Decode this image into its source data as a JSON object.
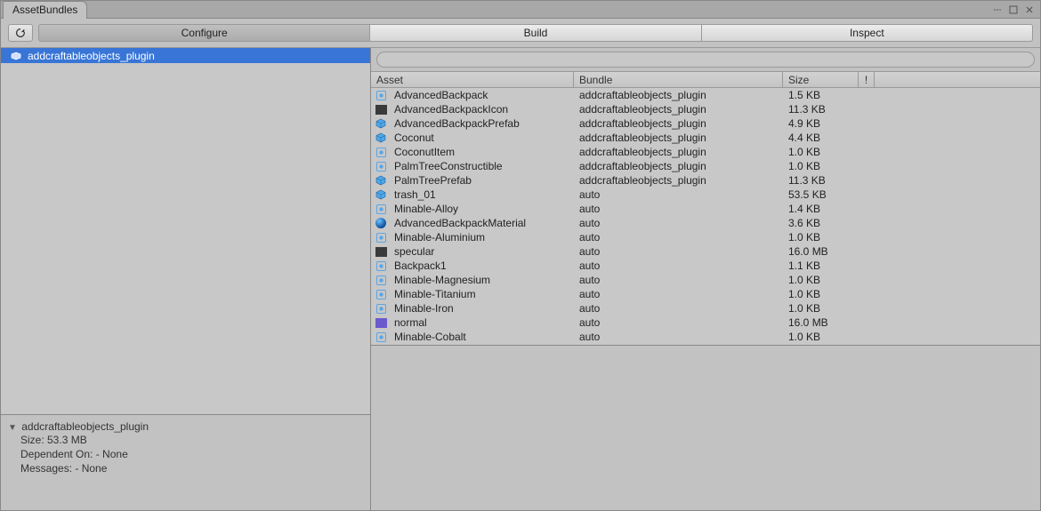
{
  "window": {
    "title": "AssetBundles"
  },
  "tabs": {
    "configure": "Configure",
    "build": "Build",
    "inspect": "Inspect",
    "active": "configure"
  },
  "search": {
    "placeholder": ""
  },
  "sidebar": {
    "bundles": [
      {
        "name": "addcraftableobjects_plugin",
        "selected": true
      }
    ]
  },
  "details": {
    "title": "addcraftableobjects_plugin",
    "lines": [
      "Size: 53.3 MB",
      "Dependent On: - None",
      "Messages: - None"
    ]
  },
  "columns": {
    "asset": "Asset",
    "bundle": "Bundle",
    "size": "Size",
    "warn": "!"
  },
  "assets": [
    {
      "icon": "flare",
      "name": "AdvancedBackpack",
      "bundle": "addcraftableobjects_plugin",
      "size": "1.5 KB"
    },
    {
      "icon": "imgdark",
      "name": "AdvancedBackpackIcon",
      "bundle": "addcraftableobjects_plugin",
      "size": "11.3 KB"
    },
    {
      "icon": "cube",
      "name": "AdvancedBackpackPrefab",
      "bundle": "addcraftableobjects_plugin",
      "size": "4.9 KB"
    },
    {
      "icon": "cube",
      "name": "Coconut",
      "bundle": "addcraftableobjects_plugin",
      "size": "4.4 KB"
    },
    {
      "icon": "flare",
      "name": "CoconutItem",
      "bundle": "addcraftableobjects_plugin",
      "size": "1.0 KB"
    },
    {
      "icon": "flare",
      "name": "PalmTreeConstructible",
      "bundle": "addcraftableobjects_plugin",
      "size": "1.0 KB"
    },
    {
      "icon": "cube",
      "name": "PalmTreePrefab",
      "bundle": "addcraftableobjects_plugin",
      "size": "11.3 KB"
    },
    {
      "icon": "cube",
      "name": "trash_01",
      "bundle": "auto",
      "size": "53.5 KB"
    },
    {
      "icon": "flare",
      "name": "Minable-Alloy",
      "bundle": "auto",
      "size": "1.4 KB"
    },
    {
      "icon": "sphere",
      "name": "AdvancedBackpackMaterial",
      "bundle": "auto",
      "size": "3.6 KB"
    },
    {
      "icon": "flare",
      "name": "Minable-Aluminium",
      "bundle": "auto",
      "size": "1.0 KB"
    },
    {
      "icon": "imgdark",
      "name": "specular",
      "bundle": "auto",
      "size": "16.0 MB"
    },
    {
      "icon": "flare",
      "name": "Backpack1",
      "bundle": "auto",
      "size": "1.1 KB"
    },
    {
      "icon": "flare",
      "name": "Minable-Magnesium",
      "bundle": "auto",
      "size": "1.0 KB"
    },
    {
      "icon": "flare",
      "name": "Minable-Titanium",
      "bundle": "auto",
      "size": "1.0 KB"
    },
    {
      "icon": "flare",
      "name": "Minable-Iron",
      "bundle": "auto",
      "size": "1.0 KB"
    },
    {
      "icon": "imgpurp",
      "name": "normal",
      "bundle": "auto",
      "size": "16.0 MB"
    },
    {
      "icon": "flare",
      "name": "Minable-Cobalt",
      "bundle": "auto",
      "size": "1.0 KB"
    }
  ],
  "colors": {
    "selection": "#3875d6",
    "panel": "#c2c2c2",
    "cubeBlue": "#4fa8e8"
  }
}
